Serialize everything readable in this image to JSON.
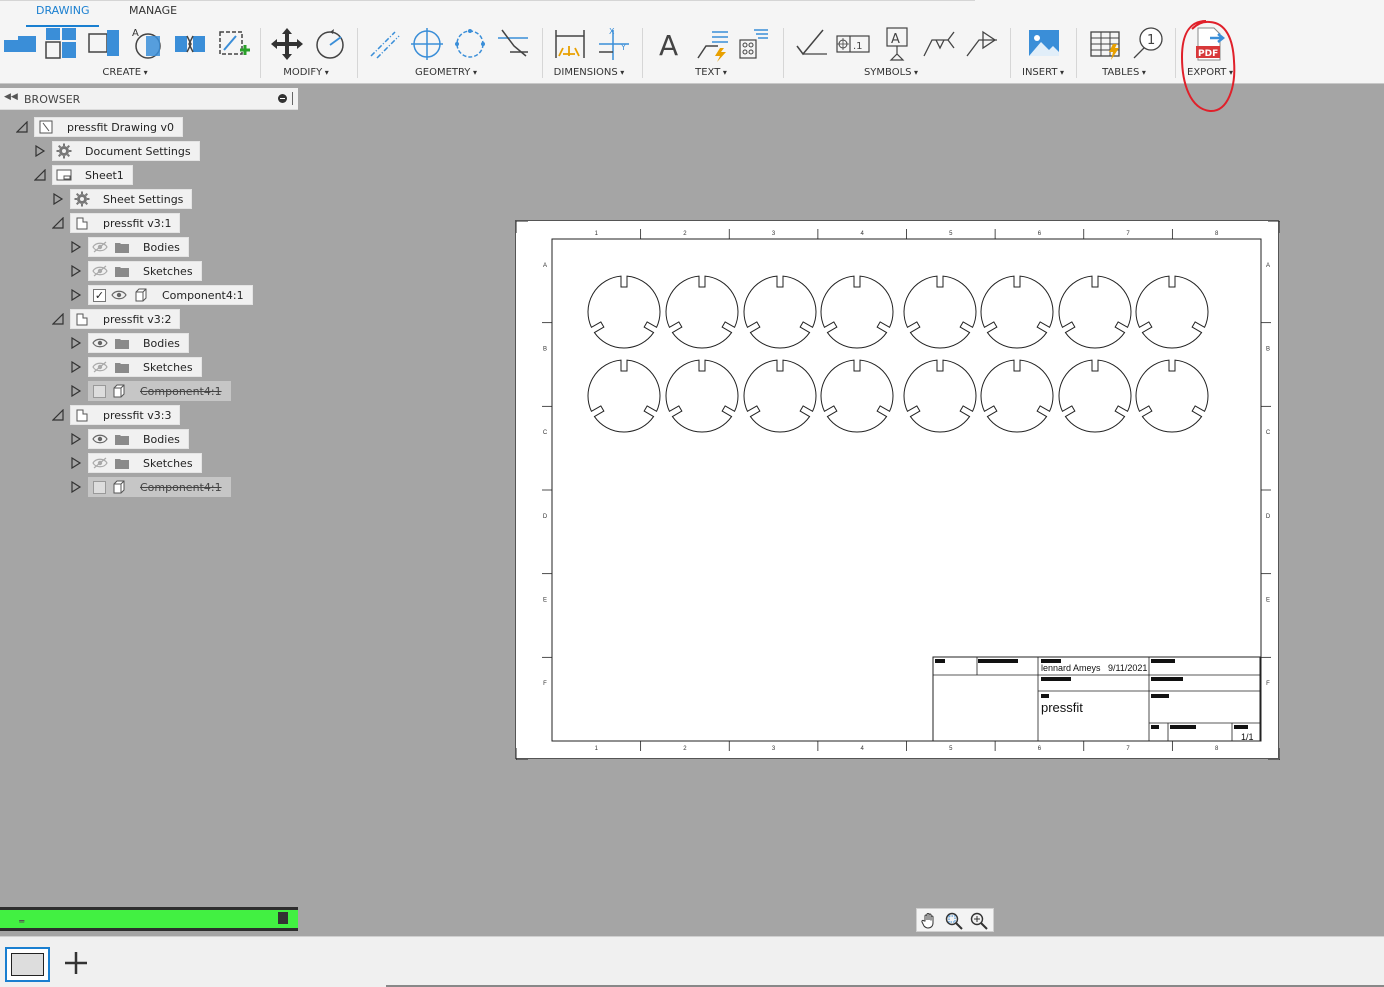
{
  "ribbon": {
    "tabs": [
      {
        "label": "DRAWING",
        "active": true
      },
      {
        "label": "MANAGE",
        "active": false
      }
    ],
    "groups": {
      "create": "CREATE",
      "modify": "MODIFY",
      "geometry": "GEOMETRY",
      "dimensions": "DIMENSIONS",
      "text": "TEXT",
      "symbols": "SYMBOLS",
      "insert": "INSERT",
      "tables": "TABLES",
      "export": "EXPORT"
    },
    "export_icon_text": "PDF",
    "balloon_text": "1",
    "accent_color": "#1a7fd0",
    "annotation_color": "#e0202a"
  },
  "browser": {
    "title": "BROWSER",
    "tree": [
      {
        "label": "pressfit Drawing v0",
        "icon": "drawing-icon"
      },
      {
        "label": "Document Settings",
        "icon": "gear-icon"
      },
      {
        "label": "Sheet1",
        "icon": "sheet-icon"
      },
      {
        "label": "Sheet Settings",
        "icon": "gear-icon"
      },
      {
        "label": "pressfit v3:1",
        "icon": "component-icon"
      },
      {
        "label": "Bodies",
        "icon": "folder-icon",
        "visible": false
      },
      {
        "label": "Sketches",
        "icon": "folder-icon",
        "visible": false
      },
      {
        "label": "Component4:1",
        "icon": "body-icon",
        "checked": true,
        "visible": true
      },
      {
        "label": "pressfit v3:2",
        "icon": "component-icon"
      },
      {
        "label": "Bodies",
        "icon": "folder-icon",
        "visible": true
      },
      {
        "label": "Sketches",
        "icon": "folder-icon",
        "visible": false
      },
      {
        "label": "Component4:1",
        "icon": "body-icon",
        "checked": false,
        "disabled": true
      },
      {
        "label": "pressfit v3:3",
        "icon": "component-icon"
      },
      {
        "label": "Bodies",
        "icon": "folder-icon",
        "visible": true
      },
      {
        "label": "Sketches",
        "icon": "folder-icon",
        "visible": false
      },
      {
        "label": "Component4:1",
        "icon": "body-icon",
        "checked": false,
        "disabled": true
      }
    ],
    "status_text": "̳̳̳̳̳̳̳̳̳̳̳̳"
  },
  "sheet": {
    "column_labels": [
      "1",
      "2",
      "3",
      "4",
      "5",
      "6",
      "7",
      "8"
    ],
    "row_labels": [
      "A",
      "B",
      "C",
      "D",
      "E",
      "F"
    ],
    "part_grid": {
      "rows": 2,
      "columns": 8
    },
    "title_block": {
      "author": "lennard Ameys",
      "date": "9/11/2021",
      "title": "pressfit",
      "sheet": "1/1"
    }
  }
}
